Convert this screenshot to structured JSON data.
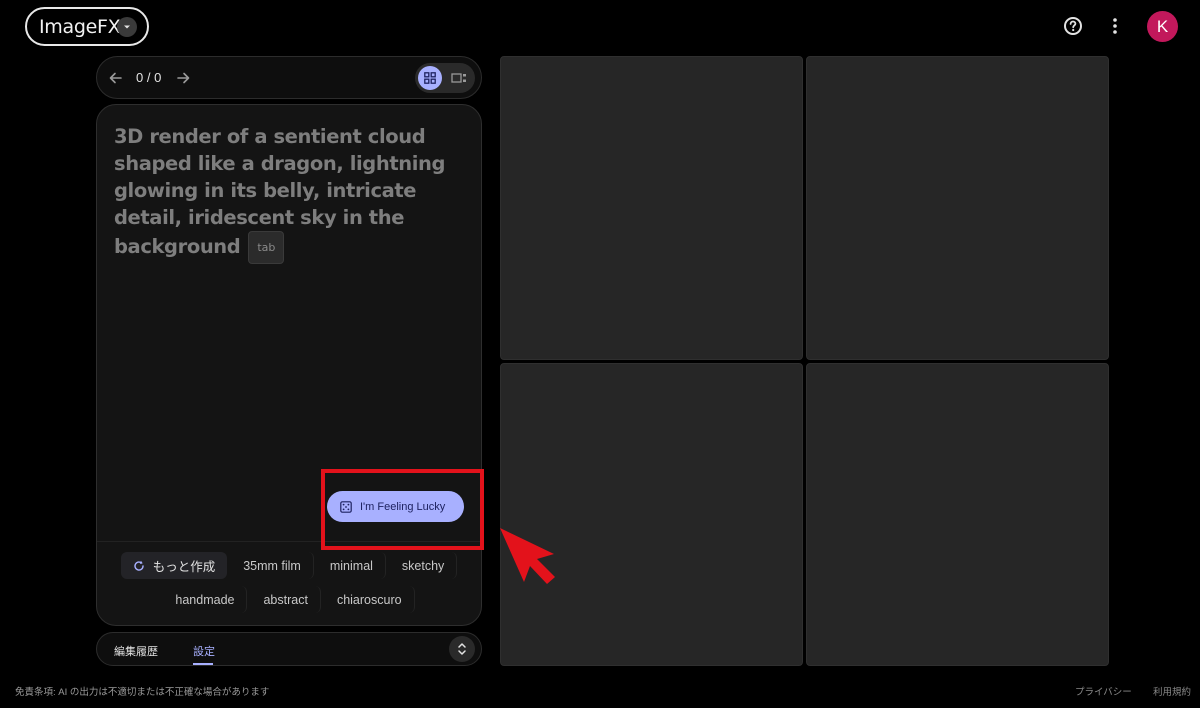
{
  "app": {
    "title": "ImageFX"
  },
  "header": {
    "avatar_letter": "K",
    "icons": [
      "help-icon",
      "more-vert-icon"
    ]
  },
  "navigation": {
    "counter": "0 / 0",
    "view_modes": [
      "grid",
      "single"
    ],
    "active_view": "grid"
  },
  "prompt": {
    "placeholder_text": "3D render of a sentient cloud shaped like a dragon, lightning glowing in its belly, intricate detail, iridescent sky in the background",
    "tab_hint": "tab"
  },
  "lucky_button": {
    "label": "I'm Feeling Lucky"
  },
  "chips": {
    "more_label": "もっと作成",
    "row1": [
      "35mm film",
      "minimal",
      "sketchy"
    ],
    "row2": [
      "handmade",
      "abstract",
      "chiaroscuro"
    ]
  },
  "bottom_tabs": {
    "items": [
      "編集履歴",
      "設定"
    ],
    "active": "設定"
  },
  "footer": {
    "disclaimer": "免責条項: AI の出力は不適切または不正確な場合があります",
    "privacy": "プライバシー",
    "terms": "利用規約"
  },
  "colors": {
    "accent": "#a8b0ff",
    "avatar": "#c2185b",
    "annotation": "#e3121b",
    "tile": "#262626"
  }
}
